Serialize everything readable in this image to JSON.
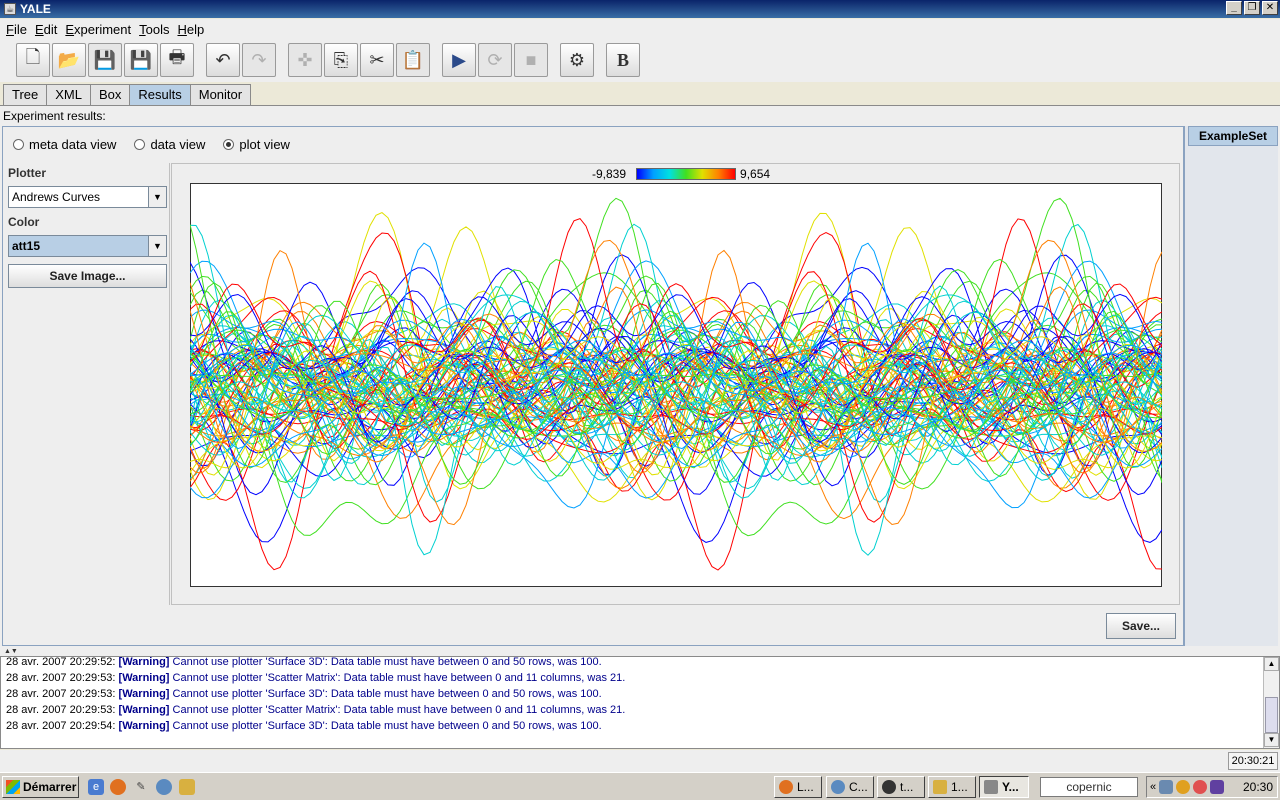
{
  "window": {
    "title": "YALE"
  },
  "menu": [
    {
      "label": "File",
      "mnemonic": "F",
      "rest": "ile"
    },
    {
      "label": "Edit",
      "mnemonic": "E",
      "rest": "dit"
    },
    {
      "label": "Experiment",
      "mnemonic": "E",
      "rest": "xperiment"
    },
    {
      "label": "Tools",
      "mnemonic": "T",
      "rest": "ools"
    },
    {
      "label": "Help",
      "mnemonic": "H",
      "rest": "elp"
    }
  ],
  "toolbar": [
    {
      "name": "new-icon",
      "glyph": "🗋",
      "enabled": true
    },
    {
      "name": "open-icon",
      "glyph": "📂",
      "enabled": true
    },
    {
      "name": "save-icon",
      "glyph": "💾",
      "enabled": false
    },
    {
      "name": "save-as-icon",
      "glyph": "💾",
      "enabled": true
    },
    {
      "name": "print-icon",
      "glyph": "🖶",
      "enabled": true
    },
    {
      "name": "undo-icon",
      "glyph": "↶",
      "enabled": true
    },
    {
      "name": "redo-icon",
      "glyph": "↷",
      "enabled": false
    },
    {
      "name": "puzzle-icon",
      "glyph": "✜",
      "enabled": false
    },
    {
      "name": "copy-icon",
      "glyph": "⎘",
      "enabled": true
    },
    {
      "name": "cut-icon",
      "glyph": "✂",
      "enabled": true
    },
    {
      "name": "paste-icon",
      "glyph": "📋",
      "enabled": false
    },
    {
      "name": "run-icon",
      "glyph": "▶",
      "enabled": true
    },
    {
      "name": "resume-icon",
      "glyph": "⟳",
      "enabled": false
    },
    {
      "name": "stop-icon",
      "glyph": "■",
      "enabled": false
    },
    {
      "name": "wizard-icon",
      "glyph": "⚙",
      "enabled": true
    },
    {
      "name": "breakpoint-icon",
      "glyph": "B",
      "enabled": true
    }
  ],
  "tabs": [
    "Tree",
    "XML",
    "Box",
    "Results",
    "Monitor"
  ],
  "active_tab": "Results",
  "results": {
    "title": "Experiment results:",
    "views": [
      "meta data view",
      "data view",
      "plot view"
    ],
    "selected_view": "plot view",
    "side_tab": "ExampleSet",
    "plotter_label": "Plotter",
    "plotter_value": "Andrews Curves",
    "color_label": "Color",
    "color_value": "att15",
    "save_image_label": "Save Image...",
    "save_label": "Save...",
    "scale_min": "-9,839",
    "scale_max": "9,654"
  },
  "chart_data": {
    "type": "line",
    "title": "",
    "description_key": "andrews-curves",
    "series_count": 100,
    "color_attribute": "att15",
    "color_range": [
      -9.839,
      9.654
    ],
    "palette": [
      "#0000ff",
      "#00a0ff",
      "#00d0d0",
      "#40e020",
      "#e0e000",
      "#ff8000",
      "#ff0000"
    ]
  },
  "log": [
    {
      "ts": "28 avr. 2007 20:29:52:",
      "level": "[Warning]",
      "msg": "Cannot use plotter 'Surface 3D': Data table must have between 0 and 50 rows, was 100."
    },
    {
      "ts": "28 avr. 2007 20:29:53:",
      "level": "[Warning]",
      "msg": "Cannot use plotter 'Scatter Matrix': Data table must have between 0 and 11 columns, was 21."
    },
    {
      "ts": "28 avr. 2007 20:29:53:",
      "level": "[Warning]",
      "msg": "Cannot use plotter 'Surface 3D': Data table must have between 0 and 50 rows, was 100."
    },
    {
      "ts": "28 avr. 2007 20:29:53:",
      "level": "[Warning]",
      "msg": "Cannot use plotter 'Scatter Matrix': Data table must have between 0 and 11 columns, was 21."
    },
    {
      "ts": "28 avr. 2007 20:29:54:",
      "level": "[Warning]",
      "msg": "Cannot use plotter 'Surface 3D': Data table must have between 0 and 50 rows, was 100."
    }
  ],
  "status": {
    "clock": "20:30:21"
  },
  "taskbar": {
    "start_label": "Démarrer",
    "tasks": [
      {
        "label": "L...",
        "active": false
      },
      {
        "label": "C...",
        "active": false
      },
      {
        "label": "t...",
        "active": false
      },
      {
        "label": "1...",
        "active": false
      },
      {
        "label": "Y...",
        "active": true
      }
    ],
    "search": "copernic",
    "tray_time": "20:30"
  }
}
